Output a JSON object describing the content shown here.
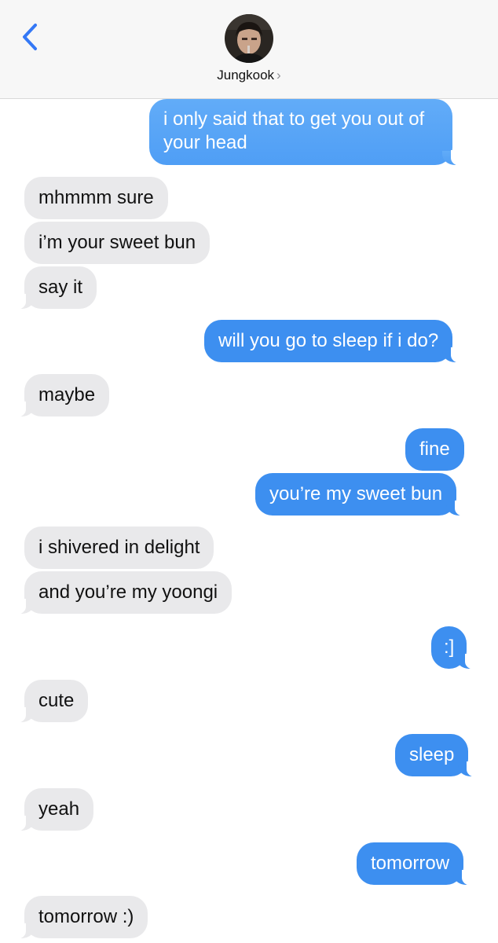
{
  "header": {
    "contact_name": "Jungkook",
    "chevron": "›"
  },
  "messages": [
    {
      "side": "out",
      "text": "i only said that to get you out of your head"
    },
    {
      "side": "in",
      "text": "mhmmm sure"
    },
    {
      "side": "in",
      "text": "i’m your sweet bun"
    },
    {
      "side": "in",
      "text": "say it"
    },
    {
      "side": "out",
      "text": "will you go to sleep if i do?"
    },
    {
      "side": "in",
      "text": "maybe"
    },
    {
      "side": "out",
      "text": "fine"
    },
    {
      "side": "out",
      "text": "you’re my sweet bun"
    },
    {
      "side": "in",
      "text": "i shivered in delight"
    },
    {
      "side": "in",
      "text": "and you’re my yoongi"
    },
    {
      "side": "out",
      "text": ":]"
    },
    {
      "side": "in",
      "text": "cute"
    },
    {
      "side": "out",
      "text": "sleep"
    },
    {
      "side": "in",
      "text": "yeah"
    },
    {
      "side": "out",
      "text": "tomorrow"
    },
    {
      "side": "in",
      "text": "tomorrow :)"
    }
  ],
  "colors": {
    "outgoing": "#3d8ff0",
    "incoming": "#e9e9eb",
    "accent": "#3478f6"
  },
  "icons": {
    "back": "chevron-left-icon",
    "avatar": "contact-avatar"
  }
}
